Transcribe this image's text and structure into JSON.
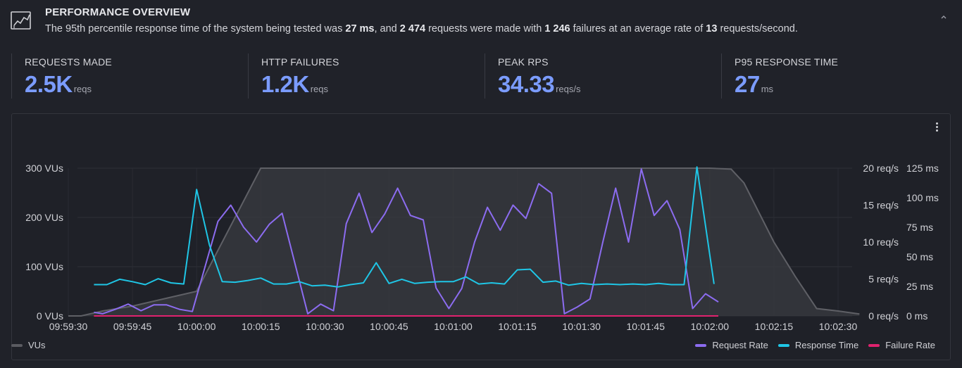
{
  "header": {
    "title": "PERFORMANCE OVERVIEW",
    "icon": "line-chart-icon",
    "summary_parts": {
      "p1": "The 95th percentile response time of the system being tested was ",
      "b1": "27 ms",
      "p2": ", and ",
      "b2": "2 474",
      "p3": " requests were made with ",
      "b3": "1 246",
      "p4": " failures at an average rate of ",
      "b4": "13",
      "p5": " requests/second."
    },
    "collapse_icon": "chevron-up-icon"
  },
  "stats": [
    {
      "label": "REQUESTS MADE",
      "value": "2.5K",
      "unit": "reqs"
    },
    {
      "label": "HTTP FAILURES",
      "value": "1.2K",
      "unit": "reqs"
    },
    {
      "label": "PEAK RPS",
      "value": "34.33",
      "unit": "reqs/s"
    },
    {
      "label": "P95 RESPONSE TIME",
      "value": "27",
      "unit": "ms"
    }
  ],
  "colors": {
    "accent": "#7b9cff",
    "vus": "#5a5b61",
    "request_rate": "#8c6cf0",
    "response_time": "#1fc6e6",
    "failure_rate": "#e0226e"
  },
  "chart_data": {
    "type": "line",
    "x_ticks": [
      "09:59:30",
      "09:59:45",
      "10:00:00",
      "10:00:15",
      "10:00:30",
      "10:00:45",
      "10:01:00",
      "10:01:15",
      "10:01:30",
      "10:01:45",
      "10:02:00",
      "10:02:15",
      "10:02:30"
    ],
    "y_left": {
      "ticks": [
        "0 VUs",
        "100 VUs",
        "200 VUs",
        "300 VUs"
      ],
      "range": [
        0,
        300
      ]
    },
    "y_right_rps": {
      "ticks": [
        "0 req/s",
        "5 req/s",
        "10 req/s",
        "15 req/s",
        "20 req/s"
      ],
      "range": [
        0,
        20
      ]
    },
    "y_right_ms": {
      "ticks": [
        "0 ms",
        "25 ms",
        "50 ms",
        "75 ms",
        "100 ms",
        "125 ms"
      ],
      "range": [
        0,
        125
      ]
    },
    "legend_position": "bottom",
    "series": [
      {
        "name": "VUs",
        "axis": "vus",
        "points": [
          [
            0,
            0
          ],
          [
            3,
            0
          ],
          [
            8,
            10
          ],
          [
            15,
            20
          ],
          [
            20,
            30
          ],
          [
            25,
            40
          ],
          [
            30,
            50
          ],
          [
            45,
            300
          ],
          [
            150,
            300
          ],
          [
            155,
            298
          ],
          [
            158,
            270
          ],
          [
            165,
            150
          ],
          [
            170,
            80
          ],
          [
            175,
            15
          ],
          [
            180,
            10
          ],
          [
            185,
            4
          ]
        ]
      },
      {
        "name": "Request Rate",
        "axis": "rps",
        "points": [
          [
            6,
            0.5
          ],
          [
            8,
            0.3
          ],
          [
            11,
            0.9
          ],
          [
            14,
            1.6
          ],
          [
            17,
            0.7
          ],
          [
            20,
            1.5
          ],
          [
            23,
            1.5
          ],
          [
            26,
            0.9
          ],
          [
            29,
            0.6
          ],
          [
            35,
            12.8
          ],
          [
            38,
            15
          ],
          [
            41,
            12
          ],
          [
            44,
            10
          ],
          [
            47,
            12.4
          ],
          [
            50,
            13.9
          ],
          [
            56,
            0.3
          ],
          [
            59,
            1.6
          ],
          [
            62,
            0.7
          ],
          [
            65,
            12.5
          ],
          [
            68,
            16.6
          ],
          [
            71,
            11.3
          ],
          [
            74,
            13.8
          ],
          [
            77,
            17.3
          ],
          [
            80,
            13.6
          ],
          [
            83,
            13
          ],
          [
            86,
            3.8
          ],
          [
            89,
            1
          ],
          [
            92,
            3.7
          ],
          [
            95,
            10
          ],
          [
            98,
            14.7
          ],
          [
            101,
            11.6
          ],
          [
            104,
            15
          ],
          [
            107,
            13.2
          ],
          [
            110,
            17.9
          ],
          [
            113,
            16.6
          ],
          [
            116,
            0.3
          ],
          [
            119,
            1.2
          ],
          [
            122,
            2.3
          ],
          [
            125,
            10
          ],
          [
            128,
            17.3
          ],
          [
            131,
            10
          ],
          [
            134,
            19.9
          ],
          [
            137,
            13.6
          ],
          [
            140,
            15.6
          ],
          [
            143,
            11.7
          ],
          [
            146,
            1
          ],
          [
            149,
            3
          ],
          [
            152,
            1.9
          ]
        ]
      },
      {
        "name": "Response Time",
        "axis": "ms",
        "points": [
          [
            6,
            26.5
          ],
          [
            9,
            26.5
          ],
          [
            12,
            31
          ],
          [
            15,
            29
          ],
          [
            18,
            26.5
          ],
          [
            21,
            31.5
          ],
          [
            24,
            28
          ],
          [
            27,
            27
          ],
          [
            30,
            107
          ],
          [
            33,
            60
          ],
          [
            36,
            29
          ],
          [
            39,
            28.5
          ],
          [
            42,
            30
          ],
          [
            45,
            32
          ],
          [
            48,
            27
          ],
          [
            51,
            27
          ],
          [
            54,
            29
          ],
          [
            57,
            25.5
          ],
          [
            60,
            26
          ],
          [
            63,
            24.5
          ],
          [
            66,
            26.5
          ],
          [
            69,
            28
          ],
          [
            72,
            45
          ],
          [
            75,
            27.5
          ],
          [
            78,
            31
          ],
          [
            81,
            27.5
          ],
          [
            84,
            28.5
          ],
          [
            87,
            29
          ],
          [
            90,
            29
          ],
          [
            93,
            33
          ],
          [
            96,
            27
          ],
          [
            99,
            28
          ],
          [
            102,
            27
          ],
          [
            105,
            39
          ],
          [
            108,
            39.5
          ],
          [
            111,
            28.5
          ],
          [
            114,
            29.5
          ],
          [
            117,
            26
          ],
          [
            120,
            27.5
          ],
          [
            123,
            26.5
          ],
          [
            126,
            27
          ],
          [
            129,
            26.5
          ],
          [
            132,
            27
          ],
          [
            135,
            26.5
          ],
          [
            138,
            27.5
          ],
          [
            141,
            26.5
          ],
          [
            144,
            26.5
          ],
          [
            147,
            126
          ],
          [
            151,
            27
          ]
        ]
      },
      {
        "name": "Failure Rate",
        "axis": "rps",
        "points": [
          [
            6,
            0
          ],
          [
            152,
            0
          ]
        ]
      }
    ]
  }
}
